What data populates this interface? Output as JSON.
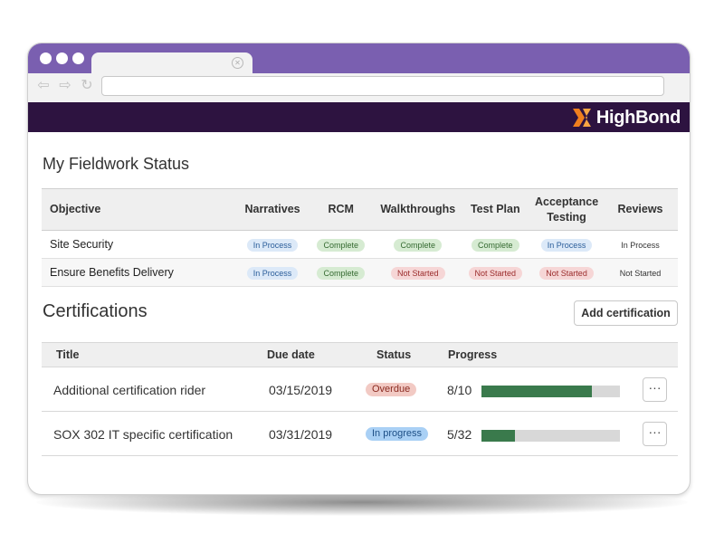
{
  "browser": {
    "tab_close_icon": "close-circle-icon",
    "nav_icons": [
      "back-arrow-icon",
      "forward-arrow-icon",
      "reload-icon"
    ],
    "url": ""
  },
  "brand": {
    "name": "HighBond",
    "accent": "#f07f1e",
    "appbar_color": "#2d1340",
    "tabbar_color": "#7a5fb0"
  },
  "fieldwork": {
    "title": "My Fieldwork Status",
    "columns": {
      "objective": "Objective",
      "narratives": "Narratives",
      "rcm": "RCM",
      "walkthroughs": "Walkthroughs",
      "test_plan": "Test Plan",
      "acceptance_1": "Acceptance",
      "acceptance_2": "Testing",
      "reviews": "Reviews"
    },
    "rows": [
      {
        "objective": "Site Security",
        "narratives": "In Process",
        "rcm": "Complete",
        "walkthroughs": "Complete",
        "test_plan": "Complete",
        "acceptance": "In Process",
        "reviews": "In Process"
      },
      {
        "objective": "Ensure Benefits Delivery",
        "narratives": "In Process",
        "rcm": "Complete",
        "walkthroughs": "Not Started",
        "test_plan": "Not Started",
        "acceptance": "Not Started",
        "reviews": "Not Started"
      }
    ]
  },
  "certifications": {
    "title": "Certifications",
    "add_button": "Add certification",
    "columns": {
      "title": "Title",
      "due_date": "Due date",
      "status": "Status",
      "progress": "Progress"
    },
    "rows": [
      {
        "title": "Additional certification rider",
        "due_date": "03/15/2019",
        "status": "Overdue",
        "progress_label": "8/10",
        "progress_fraction": 0.8,
        "more": "···"
      },
      {
        "title": "SOX 302 IT specific certification",
        "due_date": "03/31/2019",
        "status": "In progress",
        "progress_label": "5/32",
        "progress_fraction": 0.2396,
        "more": "···"
      }
    ]
  }
}
